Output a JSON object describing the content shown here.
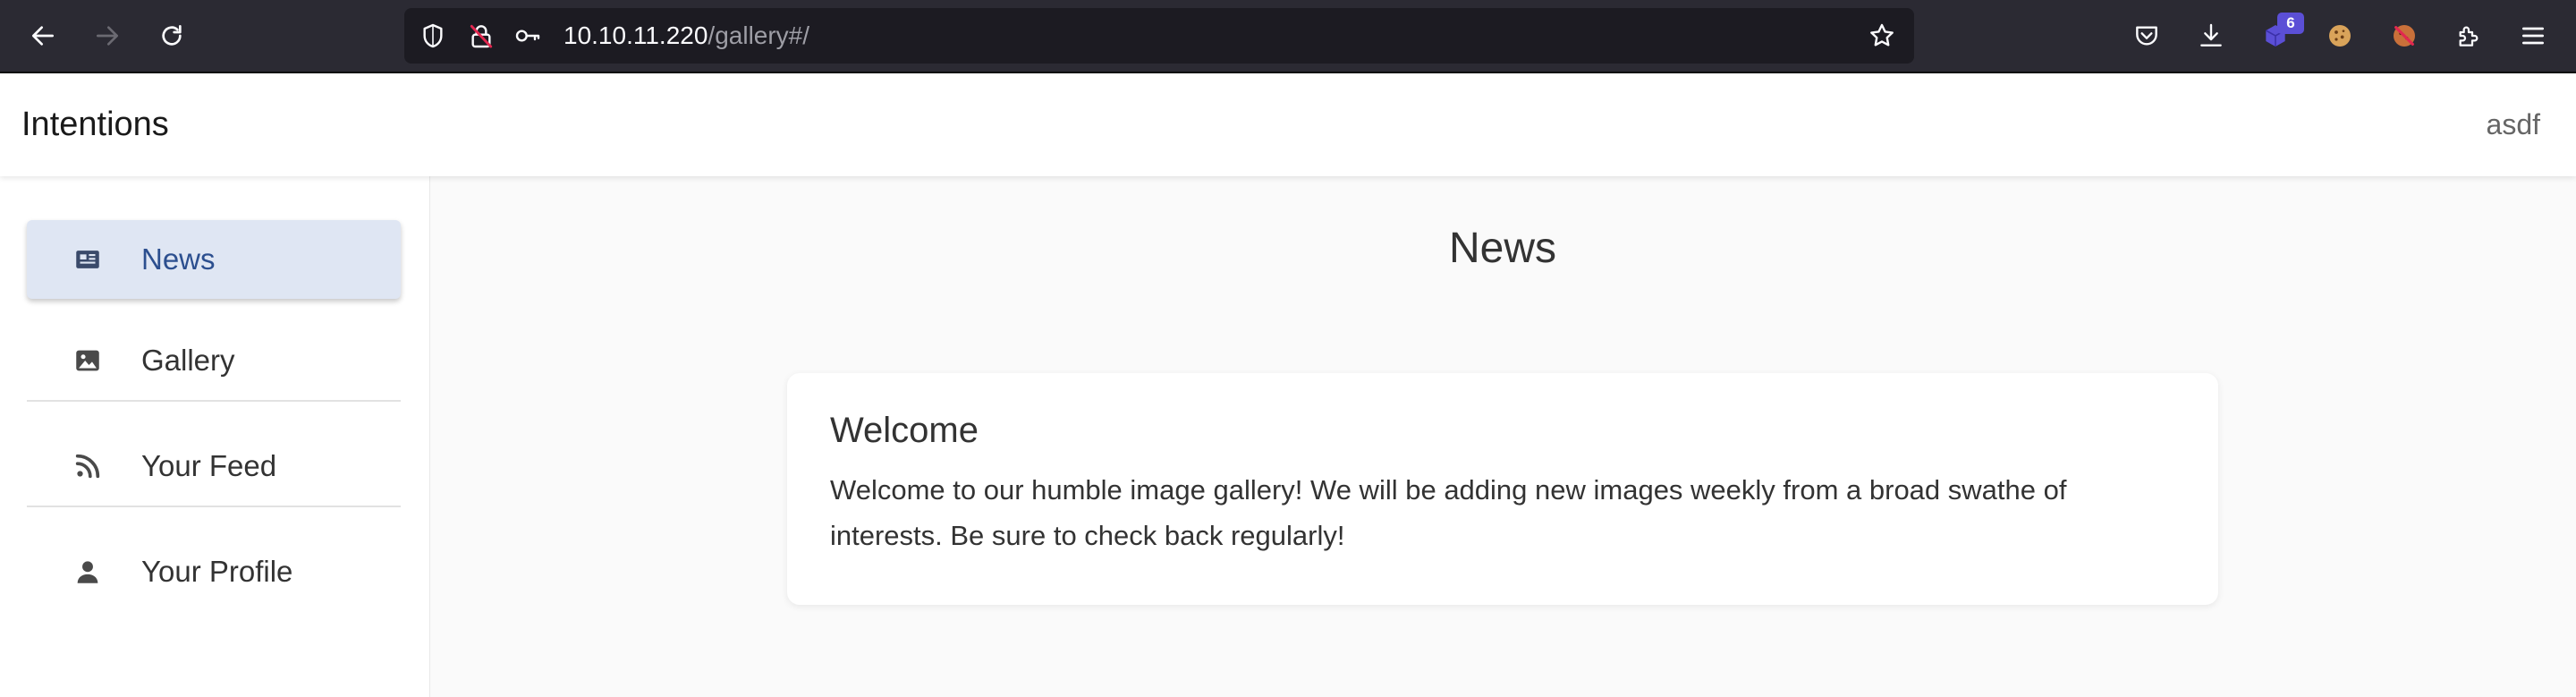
{
  "browser": {
    "url_host": "10.10.11.220",
    "url_path": "/gallery#/",
    "extension_badge": "6"
  },
  "header": {
    "app_title": "Intentions",
    "username": "asdf"
  },
  "sidebar": {
    "items": [
      {
        "label": "News",
        "icon": "newspaper-icon",
        "active": true
      },
      {
        "label": "Gallery",
        "icon": "image-icon",
        "active": false
      },
      {
        "label": "Your Feed",
        "icon": "rss-feed-icon",
        "active": false
      },
      {
        "label": "Your Profile",
        "icon": "person-icon",
        "active": false
      }
    ]
  },
  "main": {
    "title": "News",
    "card": {
      "title": "Welcome",
      "body": "Welcome to our humble image gallery! We will be adding new images weekly from a broad swathe of interests. Be sure to check back regularly!"
    }
  },
  "colors": {
    "browser_bg": "#2b2a33",
    "active_item_bg": "#dfe6f3",
    "active_item_text": "#2c4f8f",
    "page_bg": "#fafafa"
  }
}
